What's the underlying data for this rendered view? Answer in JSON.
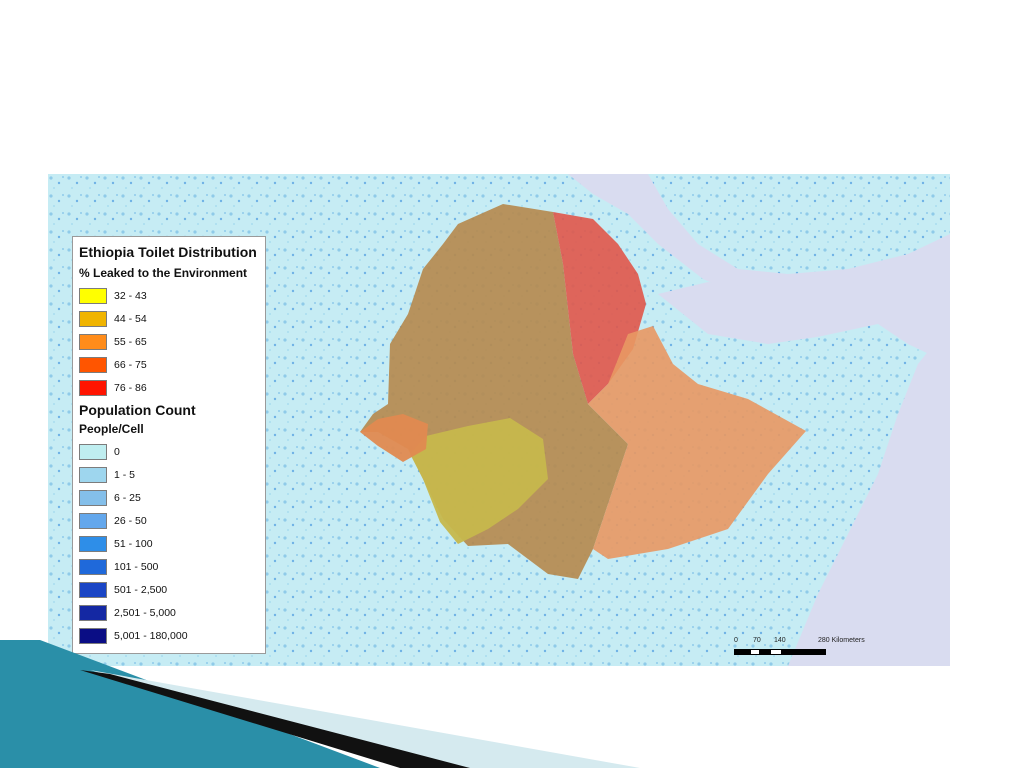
{
  "legend": {
    "title": "Ethiopia Toilet Distribution",
    "subtitle": "% Leaked to the Environment",
    "leak_classes": [
      {
        "label": "32 - 43",
        "color": "#ffff00"
      },
      {
        "label": "44 - 54",
        "color": "#f0b400"
      },
      {
        "label": "55 - 65",
        "color": "#ff8c1a"
      },
      {
        "label": "66 - 75",
        "color": "#ff5500"
      },
      {
        "label": "76 - 86",
        "color": "#ff1400"
      }
    ],
    "population_title": "Population Count",
    "population_subtitle": "People/Cell",
    "population_classes": [
      {
        "label": "0",
        "color": "#bfeef0"
      },
      {
        "label": "1 - 5",
        "color": "#9ed6ee"
      },
      {
        "label": "6 - 25",
        "color": "#84bfea"
      },
      {
        "label": "26 - 50",
        "color": "#63a7ec"
      },
      {
        "label": "51 - 100",
        "color": "#2e8ee8"
      },
      {
        "label": "101 - 500",
        "color": "#1f69da"
      },
      {
        "label": "501 - 2,500",
        "color": "#1a45c5"
      },
      {
        "label": "2,501 - 5,000",
        "color": "#1428a3"
      },
      {
        "label": "5,001 - 180,000",
        "color": "#0a0d85"
      }
    ]
  },
  "scale_bar": {
    "ticks": [
      "0",
      "70",
      "140",
      "280 Kilometers"
    ]
  },
  "colors": {
    "sea": "#d9dcf0",
    "land_base": "#c6ecf4",
    "ethiopia_main": "#b58a4f",
    "afar_region": "#e0564a",
    "south_east_region": "#e89863",
    "west_green": "#c6b84c",
    "slide_teal": "#2a8fa8",
    "slide_black": "#111111"
  }
}
